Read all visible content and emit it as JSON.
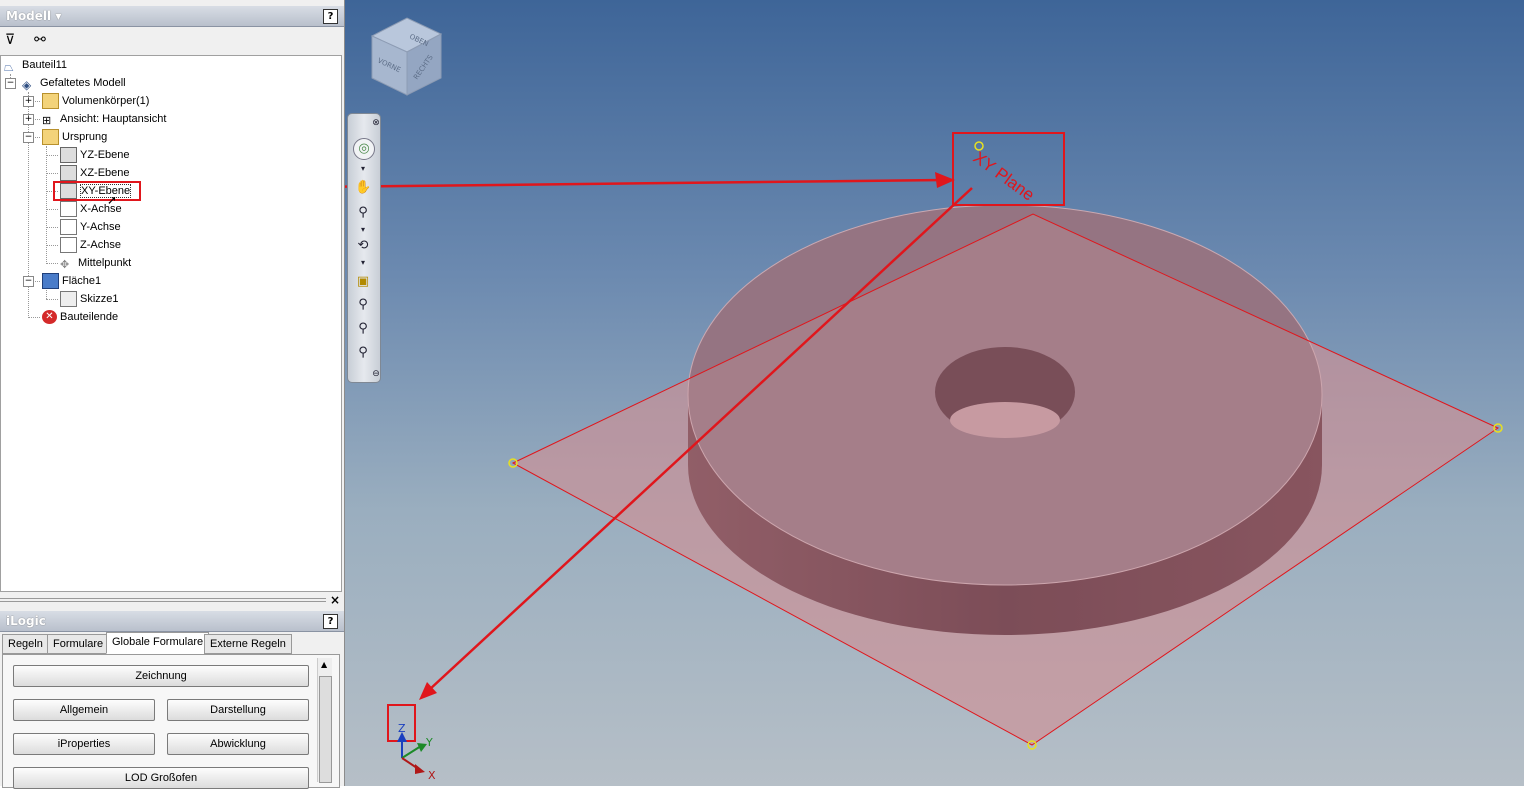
{
  "model_panel": {
    "title": "Modell",
    "help": "?",
    "tree": [
      {
        "label": "Bauteil11"
      },
      {
        "label": "Gefaltetes Modell"
      },
      {
        "label": "Volumenkörper(1)"
      },
      {
        "label": "Ansicht: Hauptansicht"
      },
      {
        "label": "Ursprung"
      },
      {
        "label": "YZ-Ebene"
      },
      {
        "label": "XZ-Ebene"
      },
      {
        "label": "XY-Ebene"
      },
      {
        "label": "X-Achse"
      },
      {
        "label": "Y-Achse"
      },
      {
        "label": "Z-Achse"
      },
      {
        "label": "Mittelpunkt"
      },
      {
        "label": "Fläche1"
      },
      {
        "label": "Skizze1"
      },
      {
        "label": "Bauteilende"
      }
    ]
  },
  "ilogic_panel": {
    "title": "iLogic",
    "help": "?",
    "tabs": [
      "Regeln",
      "Formulare",
      "Globale Formulare",
      "Externe Regeln"
    ],
    "active_tab": "Globale Formulare",
    "buttons": [
      "Zeichnung",
      "Allgemein",
      "Darstellung",
      "iProperties",
      "Abwicklung",
      "LOD Großofen"
    ]
  },
  "viewcube": {
    "top": "OBEN",
    "front": "VORNE",
    "right": "RECHTS"
  },
  "viewport": {
    "plane_label": "XY Plane",
    "triad": {
      "x": "X",
      "y": "Y",
      "z": "Z"
    }
  },
  "colors": {
    "annotation": "#e0161c",
    "plane": "#c98a90",
    "part": "#6d3d48"
  }
}
